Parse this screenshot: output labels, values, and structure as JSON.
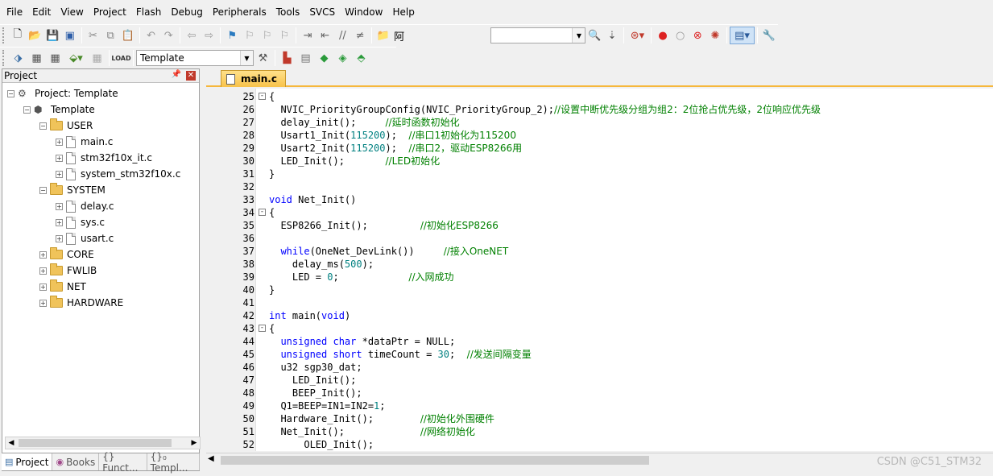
{
  "menu": [
    "File",
    "Edit",
    "View",
    "Project",
    "Flash",
    "Debug",
    "Peripherals",
    "Tools",
    "SVCS",
    "Window",
    "Help"
  ],
  "toolbar": {
    "find_text": "阿",
    "target_name": "Template"
  },
  "project_panel": {
    "title": "Project",
    "tree": {
      "root": "Project: Template",
      "target": "Template",
      "groups": [
        {
          "name": "USER",
          "files": [
            "main.c",
            "stm32f10x_it.c",
            "system_stm32f10x.c"
          ]
        },
        {
          "name": "SYSTEM",
          "files": [
            "delay.c",
            "sys.c",
            "usart.c"
          ]
        },
        {
          "name": "CORE",
          "files": []
        },
        {
          "name": "FWLIB",
          "files": []
        },
        {
          "name": "NET",
          "files": []
        },
        {
          "name": "HARDWARE",
          "files": []
        }
      ]
    },
    "bottom_tabs": [
      "Project",
      "Books",
      "{} Funct...",
      "{}₀ Templ..."
    ]
  },
  "editor": {
    "tab": "main.c",
    "lines": [
      {
        "n": "25",
        "fold": "-",
        "segs": [
          [
            "",
            "{"
          ]
        ]
      },
      {
        "n": "26",
        "segs": [
          [
            "",
            "  NVIC_PriorityGroupConfig(NVIC_PriorityGroup_2);"
          ],
          [
            "cm",
            "//设置中断优先级分组为组2：2位抢占优先级，2位响应优先级"
          ]
        ]
      },
      {
        "n": "27",
        "segs": [
          [
            "",
            "  delay_init();     "
          ],
          [
            "cm",
            "//延时函数初始化"
          ]
        ]
      },
      {
        "n": "28",
        "segs": [
          [
            "",
            "  Usart1_Init("
          ],
          [
            "num",
            "115200"
          ],
          [
            "",
            ");  "
          ],
          [
            "cm",
            "//串口1初始化为115200"
          ]
        ]
      },
      {
        "n": "29",
        "segs": [
          [
            "",
            "  Usart2_Init("
          ],
          [
            "num",
            "115200"
          ],
          [
            "",
            ");  "
          ],
          [
            "cm",
            "//串口2，驱动ESP8266用"
          ]
        ]
      },
      {
        "n": "30",
        "segs": [
          [
            "",
            "  LED_Init();       "
          ],
          [
            "cm",
            "//LED初始化"
          ]
        ]
      },
      {
        "n": "31",
        "segs": [
          [
            "",
            "}"
          ]
        ]
      },
      {
        "n": "32",
        "segs": []
      },
      {
        "n": "33",
        "segs": [
          [
            "kw",
            "void"
          ],
          [
            "",
            " Net_Init()"
          ]
        ]
      },
      {
        "n": "34",
        "fold": "-",
        "segs": [
          [
            "",
            "{"
          ]
        ]
      },
      {
        "n": "35",
        "segs": [
          [
            "",
            "  ESP8266_Init();         "
          ],
          [
            "cm",
            "//初始化ESP8266"
          ]
        ]
      },
      {
        "n": "36",
        "segs": []
      },
      {
        "n": "37",
        "segs": [
          [
            "",
            "  "
          ],
          [
            "kw",
            "while"
          ],
          [
            "",
            "(OneNet_DevLink())     "
          ],
          [
            "cm",
            "//接入OneNET"
          ]
        ]
      },
      {
        "n": "38",
        "segs": [
          [
            "",
            "    delay_ms("
          ],
          [
            "num",
            "500"
          ],
          [
            "",
            ");"
          ]
        ]
      },
      {
        "n": "39",
        "segs": [
          [
            "",
            "    LED = "
          ],
          [
            "num",
            "0"
          ],
          [
            "",
            ";            "
          ],
          [
            "cm",
            "//入网成功"
          ]
        ]
      },
      {
        "n": "40",
        "segs": [
          [
            "",
            "}"
          ]
        ]
      },
      {
        "n": "41",
        "segs": []
      },
      {
        "n": "42",
        "segs": [
          [
            "kw",
            "int"
          ],
          [
            "",
            " main("
          ],
          [
            "kw",
            "void"
          ],
          [
            "",
            ")"
          ]
        ]
      },
      {
        "n": "43",
        "fold": "-",
        "segs": [
          [
            "",
            "{"
          ]
        ]
      },
      {
        "n": "44",
        "segs": [
          [
            "",
            "  "
          ],
          [
            "kw",
            "unsigned"
          ],
          [
            "",
            " "
          ],
          [
            "kw",
            "char"
          ],
          [
            "",
            " *dataPtr = NULL;"
          ]
        ]
      },
      {
        "n": "45",
        "segs": [
          [
            "",
            "  "
          ],
          [
            "kw",
            "unsigned"
          ],
          [
            "",
            " "
          ],
          [
            "kw",
            "short"
          ],
          [
            "",
            " timeCount = "
          ],
          [
            "num",
            "30"
          ],
          [
            "",
            ";  "
          ],
          [
            "cm",
            "//发送间隔变量"
          ]
        ]
      },
      {
        "n": "46",
        "segs": [
          [
            "",
            "  u32 sgp30_dat;"
          ]
        ]
      },
      {
        "n": "47",
        "segs": [
          [
            "",
            "    LED_Init();"
          ]
        ]
      },
      {
        "n": "48",
        "segs": [
          [
            "",
            "    BEEP_Init();"
          ]
        ]
      },
      {
        "n": "49",
        "segs": [
          [
            "",
            "  Q1=BEEP=IN1=IN2="
          ],
          [
            "num",
            "1"
          ],
          [
            "",
            ";"
          ]
        ]
      },
      {
        "n": "50",
        "segs": [
          [
            "",
            "  Hardware_Init();        "
          ],
          [
            "cm",
            "//初始化外围硬件"
          ]
        ]
      },
      {
        "n": "51",
        "segs": [
          [
            "",
            "  Net_Init();             "
          ],
          [
            "cm",
            "//网络初始化"
          ]
        ]
      },
      {
        "n": "52",
        "segs": [
          [
            "",
            "      OLED_Init();"
          ]
        ]
      }
    ]
  },
  "watermark": "CSDN @C51_STM32"
}
